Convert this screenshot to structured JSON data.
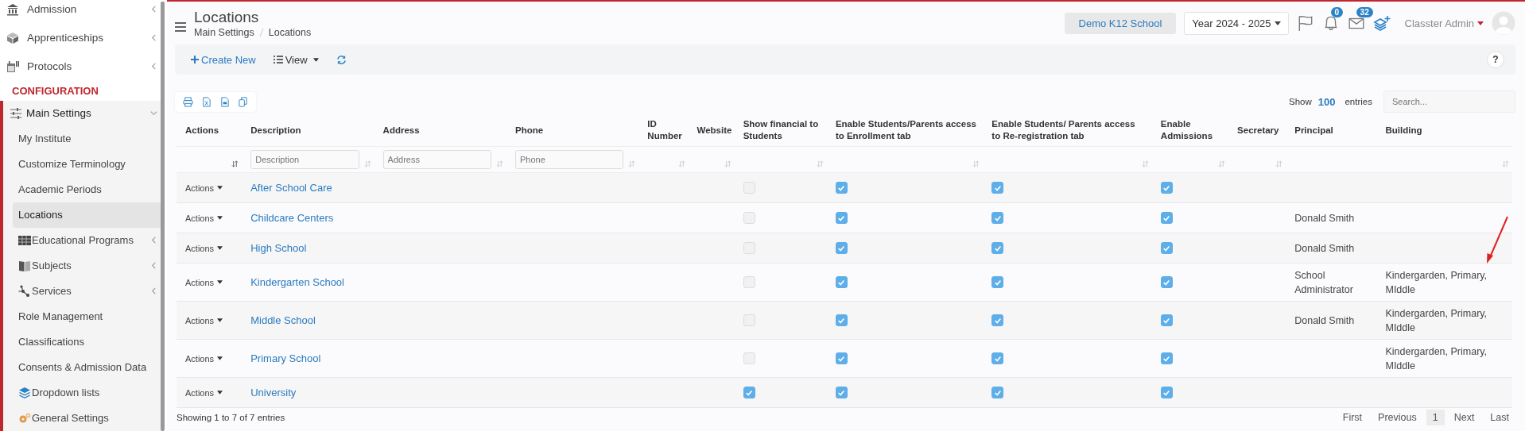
{
  "sidebar": {
    "items": [
      {
        "label": "Admission",
        "has_children": true
      },
      {
        "label": "Apprenticeships",
        "has_children": true
      },
      {
        "label": "Protocols",
        "has_children": true
      }
    ],
    "section": "CONFIGURATION",
    "group": {
      "label": "Main Settings",
      "expanded": true,
      "children": [
        {
          "label": "My Institute",
          "selected": false,
          "has_children": false
        },
        {
          "label": "Customize Terminology",
          "selected": false,
          "has_children": false
        },
        {
          "label": "Academic Periods",
          "selected": false,
          "has_children": false
        },
        {
          "label": "Locations",
          "selected": true,
          "has_children": false
        },
        {
          "label": "Educational Programs",
          "selected": false,
          "has_children": true
        },
        {
          "label": "Subjects",
          "selected": false,
          "has_children": true
        },
        {
          "label": "Services",
          "selected": false,
          "has_children": true
        },
        {
          "label": "Role Management",
          "selected": false,
          "has_children": false
        },
        {
          "label": "Classifications",
          "selected": false,
          "has_children": false
        },
        {
          "label": "Consents & Admission Data",
          "selected": false,
          "has_children": false
        },
        {
          "label": "Dropdown lists",
          "selected": false,
          "has_children": false
        },
        {
          "label": "General Settings",
          "selected": false,
          "has_children": false
        }
      ]
    }
  },
  "header": {
    "title": "Locations",
    "breadcrumbs": [
      "Main Settings",
      "Locations"
    ],
    "school": "Demo K12 School",
    "year": "Year 2024 - 2025",
    "notifications": "0",
    "messages": "32",
    "user": "Classter Admin"
  },
  "toolbar": {
    "create": "Create New",
    "view": "View",
    "help": "?"
  },
  "table": {
    "length": {
      "show": "Show",
      "value": "100",
      "entries": "entries"
    },
    "search": {
      "placeholder": "Search..."
    },
    "columns": [
      {
        "label": "Actions"
      },
      {
        "label": "Description",
        "placeholder": "Description"
      },
      {
        "label": "Address",
        "placeholder": "Address"
      },
      {
        "label": "Phone",
        "placeholder": "Phone"
      },
      {
        "label": "ID Number"
      },
      {
        "label": "Website"
      },
      {
        "label": "Show financial to Students"
      },
      {
        "label": "Enable Students/Parents access to Enrollment tab"
      },
      {
        "label": "Enable Students/ Parents access to Re-registration tab"
      },
      {
        "label": "Enable Admissions"
      },
      {
        "label": "Secretary"
      },
      {
        "label": "Principal"
      },
      {
        "label": "Building"
      }
    ],
    "rows": [
      {
        "actions": "Actions",
        "description": "After School Care",
        "show_financial": false,
        "enrollment": true,
        "reregistration": true,
        "admissions": true
      },
      {
        "actions": "Actions",
        "description": "Childcare Centers",
        "show_financial": false,
        "enrollment": true,
        "reregistration": true,
        "admissions": true,
        "principal": "Donald Smith"
      },
      {
        "actions": "Actions",
        "description": "High School",
        "show_financial": false,
        "enrollment": true,
        "reregistration": true,
        "admissions": true,
        "principal": "Donald Smith"
      },
      {
        "actions": "Actions",
        "description": "Kindergarten School",
        "show_financial": false,
        "enrollment": true,
        "reregistration": true,
        "admissions": true,
        "principal": "School Administrator",
        "building": "Kindergarden, Primary, MIddle"
      },
      {
        "actions": "Actions",
        "description": "Middle School",
        "show_financial": false,
        "enrollment": true,
        "reregistration": true,
        "admissions": true,
        "principal": "Donald Smith",
        "building": "Kindergarden, Primary, MIddle"
      },
      {
        "actions": "Actions",
        "description": "Primary School",
        "show_financial": false,
        "enrollment": true,
        "reregistration": true,
        "admissions": true,
        "building": "Kindergarden, Primary, MIddle"
      },
      {
        "actions": "Actions",
        "description": "University",
        "show_financial": true,
        "enrollment": true,
        "reregistration": true,
        "admissions": true
      }
    ],
    "info": "Showing 1 to 7 of 7 entries",
    "pages": [
      {
        "label": "First",
        "selected": false
      },
      {
        "label": "Previous",
        "selected": false
      },
      {
        "label": "1",
        "selected": true
      },
      {
        "label": "Next",
        "selected": false
      },
      {
        "label": "Last",
        "selected": false
      }
    ]
  }
}
